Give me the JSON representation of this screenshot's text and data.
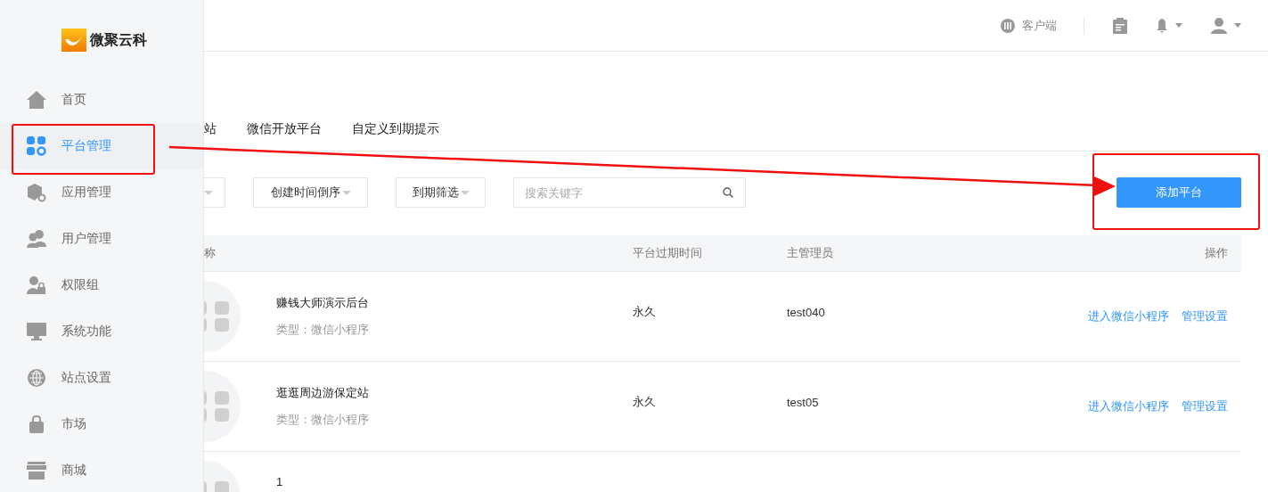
{
  "logo": {
    "text": "微聚云科"
  },
  "sidebar": {
    "items": [
      {
        "label": "首页",
        "selected": false
      },
      {
        "label": "平台管理",
        "selected": true
      },
      {
        "label": "应用管理",
        "selected": false
      },
      {
        "label": "用户管理",
        "selected": false
      },
      {
        "label": "权限组",
        "selected": false
      },
      {
        "label": "系统功能",
        "selected": false
      },
      {
        "label": "站点设置",
        "selected": false
      },
      {
        "label": "市场",
        "selected": false
      },
      {
        "label": "商城",
        "selected": false
      }
    ]
  },
  "header": {
    "client_label": "客户端"
  },
  "tabs": [
    {
      "label": "站"
    },
    {
      "label": "微信开放平台"
    },
    {
      "label": "自定义到期提示"
    }
  ],
  "filters": {
    "dropdowns": [
      {
        "label": "创建时间倒序"
      },
      {
        "label": "到期筛选"
      }
    ],
    "search": {
      "placeholder": "搜索关键字"
    }
  },
  "add_button": {
    "label": "添加平台"
  },
  "table": {
    "columns": [
      "称",
      "平台过期时间",
      "主管理员",
      "操作"
    ],
    "rows": [
      {
        "name": "赚钱大师演示后台",
        "type": "类型：微信小程序",
        "expiry": "永久",
        "admin": "test040",
        "actions": [
          "进入微信小程序",
          "管理设置"
        ]
      },
      {
        "name": "逛逛周边游保定站",
        "type": "类型：微信小程序",
        "expiry": "永久",
        "admin": "test05",
        "actions": [
          "进入微信小程序",
          "管理设置"
        ]
      },
      {
        "name": "1"
      }
    ]
  }
}
